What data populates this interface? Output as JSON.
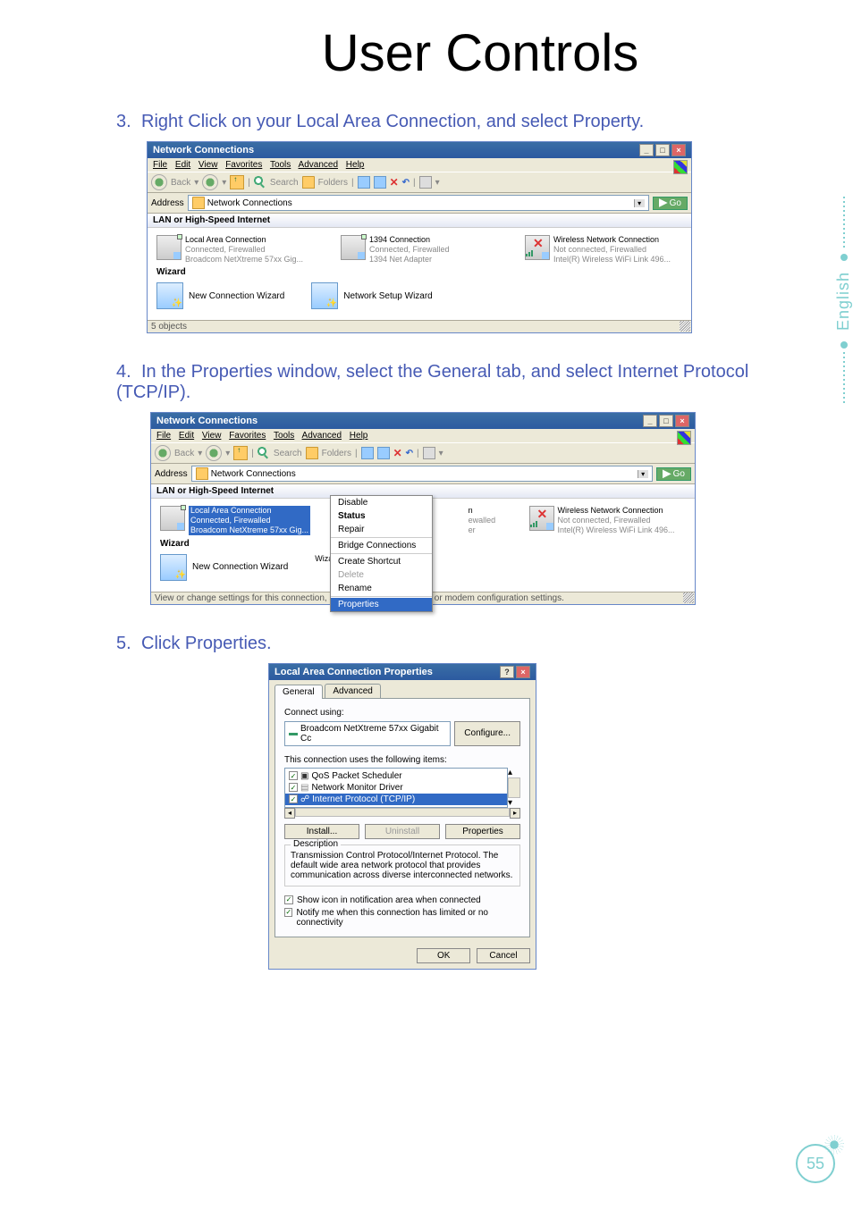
{
  "page": {
    "title": "User Controls",
    "number": "55",
    "lang_tab": "English"
  },
  "step3": {
    "num": "3.",
    "text": "Right Click on your Local Area Connection, and select Property."
  },
  "step4": {
    "num": "4.",
    "text": "In the Properties window, select the General tab, and select Internet Protocol (TCP/IP)."
  },
  "step5": {
    "num": "5.",
    "text": "Click Properties."
  },
  "win_common": {
    "title": "Network Connections",
    "menu": {
      "file": "File",
      "edit": "Edit",
      "view": "View",
      "fav": "Favorites",
      "tools": "Tools",
      "adv": "Advanced",
      "help": "Help"
    },
    "toolbar": {
      "back": "Back",
      "search": "Search",
      "folders": "Folders"
    },
    "address_label": "Address",
    "address_value": "Network Connections",
    "go": "Go",
    "section": "LAN or High-Speed Internet",
    "wizard_h": "Wizard",
    "conn1": {
      "name": "Local Area Connection",
      "s1": "Connected, Firewalled",
      "s2": "Broadcom NetXtreme 57xx Gig..."
    },
    "conn2": {
      "name": "1394 Connection",
      "s1": "Connected, Firewalled",
      "s2": "1394 Net Adapter"
    },
    "conn3": {
      "name": "Wireless Network Connection",
      "s1": "Not connected, Firewalled",
      "s2": "Intel(R) Wireless WiFi Link 496..."
    },
    "wiz1": "New Connection Wizard",
    "wiz2": "Network Setup Wizard",
    "status": "5 objects"
  },
  "win2_extra": {
    "ctx": {
      "disable": "Disable",
      "status": "Status",
      "repair": "Repair",
      "bridge": "Bridge Connections",
      "shortcut": "Create Shortcut",
      "delete": "Delete",
      "rename": "Rename",
      "props": "Properties"
    },
    "conn2_suffix": {
      "t1": "n",
      "t2": "ewalled",
      "t3": "er"
    },
    "wiz_suffix": "Wizard",
    "status": "View or change settings for this connection, such as adapter, protocol, or modem configuration settings."
  },
  "dlg": {
    "title": "Local Area Connection Properties",
    "tab1": "General",
    "tab2": "Advanced",
    "connect_using": "Connect using:",
    "adapter": "Broadcom NetXtreme 57xx Gigabit Cc",
    "configure": "Configure...",
    "uses": "This connection uses the following items:",
    "item1": "QoS Packet Scheduler",
    "item2": "Network Monitor Driver",
    "item3": "Internet Protocol (TCP/IP)",
    "install": "Install...",
    "uninstall": "Uninstall",
    "properties": "Properties",
    "desc_h": "Description",
    "desc": "Transmission Control Protocol/Internet Protocol. The default wide area network protocol that provides communication across diverse interconnected networks.",
    "opt1": "Show icon in notification area when connected",
    "opt2": "Notify me when this connection has limited or no connectivity",
    "ok": "OK",
    "cancel": "Cancel"
  }
}
